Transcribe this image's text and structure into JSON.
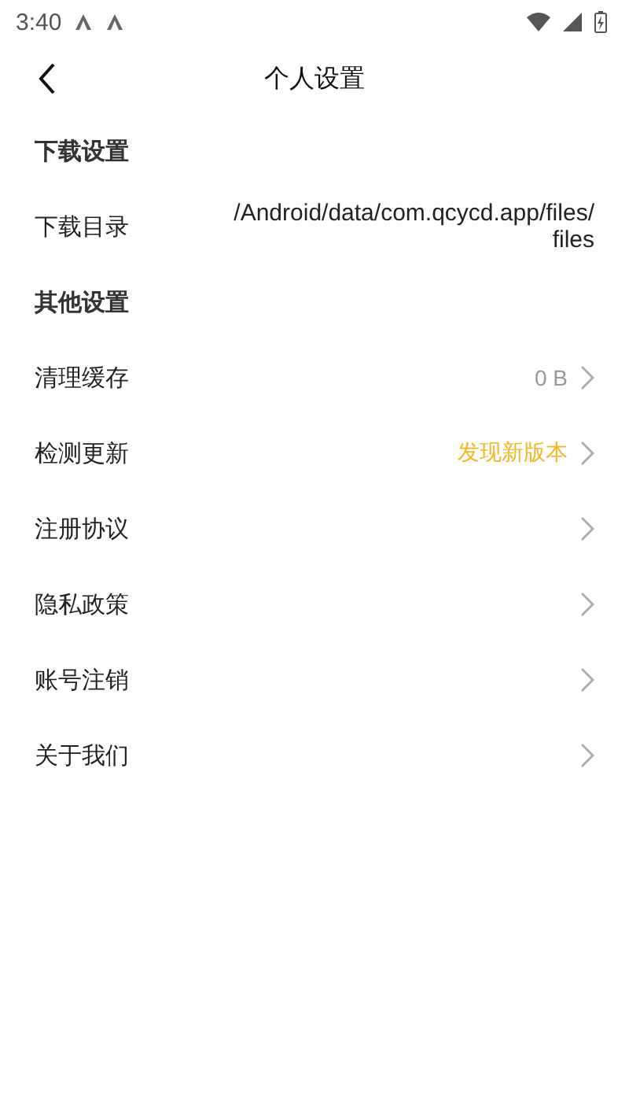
{
  "status_bar": {
    "time": "3:40"
  },
  "header": {
    "title": "个人设置"
  },
  "items": [
    {
      "kind": "section",
      "label": "下载设置"
    },
    {
      "kind": "path",
      "label": "下载目录",
      "value": "/Android/data/com.qcycd.app/files/files"
    },
    {
      "kind": "section",
      "label": "其他设置"
    },
    {
      "kind": "row",
      "label": "清理缓存",
      "value": "0 B",
      "highlight": false
    },
    {
      "kind": "row",
      "label": "检测更新",
      "value": "发现新版本",
      "highlight": true
    },
    {
      "kind": "row",
      "label": "注册协议"
    },
    {
      "kind": "row",
      "label": "隐私政策"
    },
    {
      "kind": "row",
      "label": "账号注销"
    },
    {
      "kind": "row",
      "label": "关于我们"
    }
  ]
}
